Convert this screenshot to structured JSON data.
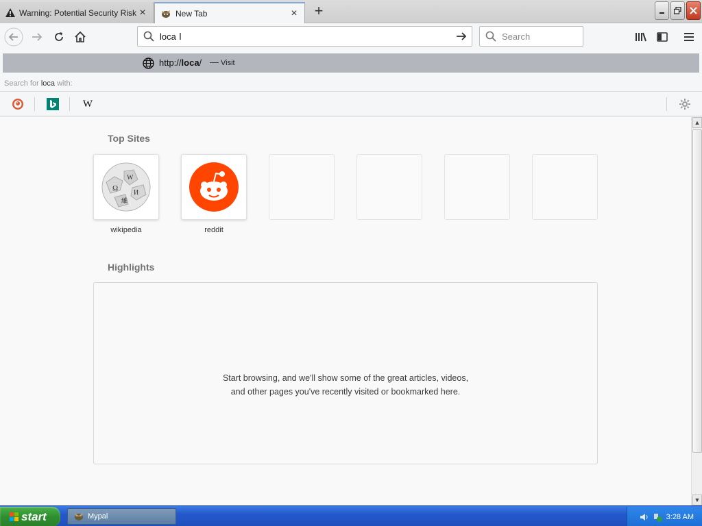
{
  "tabs": [
    {
      "title": "Warning: Potential Security Risk A",
      "icon": "warning-icon",
      "active": false
    },
    {
      "title": "New Tab",
      "icon": "browser-favicon",
      "active": true
    }
  ],
  "urlbar": {
    "value": "loca"
  },
  "searchbar": {
    "placeholder": "Search"
  },
  "dropdown": {
    "suggestion": {
      "url_prefix": "http://",
      "url_bold": "loca",
      "url_suffix": "/",
      "separator": "—",
      "action": "Visit"
    },
    "search_for": {
      "prefix": "Search for",
      "query": "loca",
      "suffix": "with:"
    },
    "engines": [
      "duckduckgo",
      "bing",
      "wikipedia"
    ],
    "wiki_letter": "W"
  },
  "content": {
    "top_sites_title": "Top Sites",
    "top_sites": [
      {
        "label": "wikipedia"
      },
      {
        "label": "reddit"
      },
      {
        "label": ""
      },
      {
        "label": ""
      },
      {
        "label": ""
      },
      {
        "label": ""
      }
    ],
    "highlights_title": "Highlights",
    "highlights_empty": "Start browsing, and we'll show some of the great articles, videos, and other pages you've recently visited or bookmarked here."
  },
  "taskbar": {
    "start_label": "start",
    "task_item": "Mypal",
    "clock": "3:28 AM"
  },
  "colors": {
    "reddit": "#ff4500",
    "selected_row": "#b4b6bd",
    "taskbar": "#245edb",
    "start": "#3c9a3c"
  }
}
